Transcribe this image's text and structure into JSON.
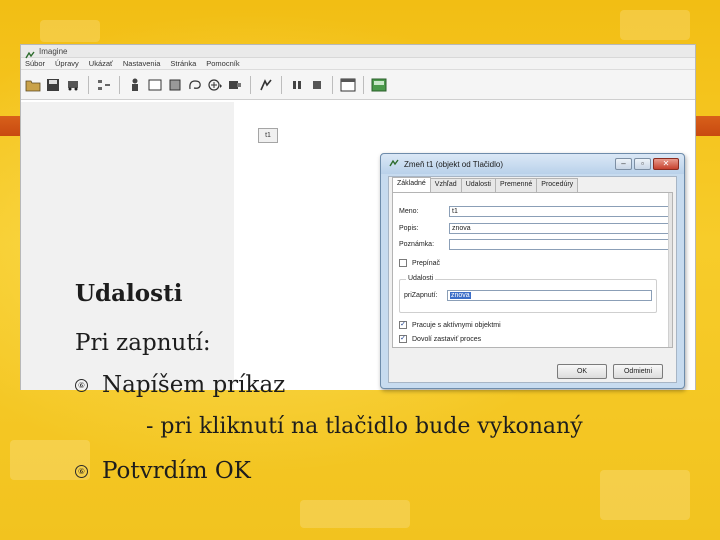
{
  "app": {
    "title": "Imagine",
    "menu": [
      "Súbor",
      "Úpravy",
      "Ukázať",
      "Nastavenia",
      "Stránka",
      "Pomocník"
    ],
    "toolbar_icons": [
      "open-folder-icon",
      "save-icon",
      "car-icon",
      "shapes-icon",
      "figure-icon",
      "rectangle-icon",
      "square-icon",
      "lasso-icon",
      "circle-plus-icon",
      "settings-icon",
      "paste-icon",
      "pause-icon",
      "stop-icon",
      "window-icon",
      "image-icon"
    ],
    "canvas_button_label": "t1"
  },
  "dialog": {
    "title": "Zmeň t1 (objekt od Tlačidlo)",
    "tabs": [
      "Základné",
      "Vzhľad",
      "Udalosti",
      "Premenné",
      "Procedúry"
    ],
    "active_tab": "Základné",
    "fields": {
      "meno_label": "Meno:",
      "meno_value": "t1",
      "popis_label": "Popis:",
      "popis_value": "znova",
      "poznamka_label": "Poznámka:",
      "poznamka_value": ""
    },
    "prepinac_label": "Prepínač",
    "prepinac_checked": false,
    "events_group": {
      "legend": "Udalosti",
      "label": "priZapnutí:",
      "value": "znova"
    },
    "checkbox_active_objects": "Pracuje s aktívnymi objektmi",
    "checkbox_active_objects_checked": true,
    "checkbox_stop_process": "Dovolí zastaviť proces",
    "checkbox_stop_process_checked": true,
    "ok_label": "OK",
    "cancel_label": "Odmietni"
  },
  "slide": {
    "heading": "Udalosti",
    "line2": "Pri zapnutí:",
    "bullet_glyph": "⑥",
    "bullet1": "Napíšem príkaz",
    "bullet1_sub": "- pri kliknutí na tlačidlo bude vykonaný",
    "bullet2": "Potvrdím OK"
  },
  "colors": {
    "slide_yellow": "#f4c21c",
    "stripe_orange": "#c84a10",
    "dialog_frame": "#c7dbef",
    "selection_blue": "#3c6ec8"
  }
}
